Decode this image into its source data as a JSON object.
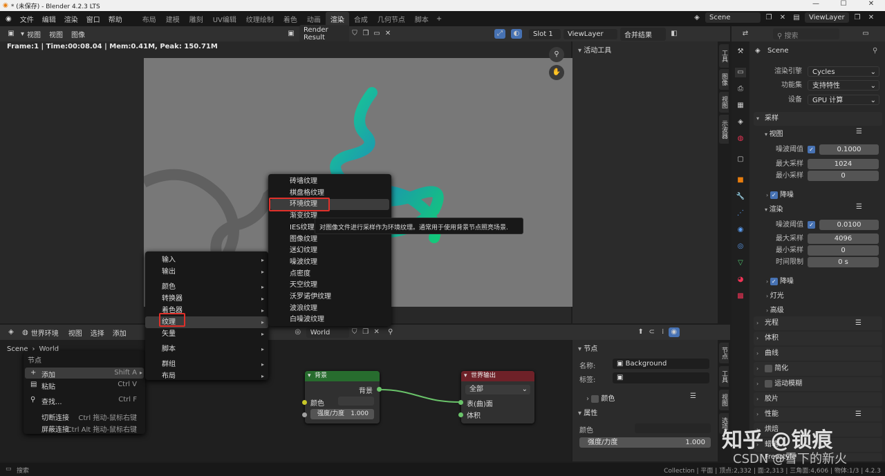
{
  "window": {
    "title": "* (未保存) - Blender 4.2.3 LTS"
  },
  "menu": [
    "文件",
    "编辑",
    "渲染",
    "窗口",
    "帮助"
  ],
  "workspaces": [
    "布局",
    "建模",
    "雕刻",
    "UV编辑",
    "纹理绘制",
    "着色",
    "动画",
    "渲染",
    "合成",
    "几何节点",
    "脚本"
  ],
  "active_workspace": "渲染",
  "top_right": {
    "scene": "Scene",
    "view_layer": "ViewLayer"
  },
  "image_editor": {
    "menus": [
      "视图",
      "视图",
      "图像"
    ],
    "image_name": "Render Result",
    "slot": "Slot 1",
    "view_layer": "ViewLayer",
    "pass": "合并结果",
    "status": "Frame:1 | Time:00:08.04 | Mem:0.41M, Peak: 150.71M",
    "sidebar_title": "活动工具",
    "sidebar_tabs": [
      "工具",
      "图像",
      "视图",
      "示波器"
    ]
  },
  "node_editor": {
    "type": "世界环境",
    "menus": [
      "视图",
      "选择",
      "添加"
    ],
    "world_name": "World",
    "breadcrumb": [
      "Scene",
      "World"
    ],
    "sidebar_tabs": [
      "节点",
      "工具",
      "视图",
      "选项"
    ],
    "nodes": {
      "background": {
        "title": "背景",
        "output": "背景",
        "color_label": "颜色",
        "strength_label": "强度/力度",
        "strength_value": "1.000"
      },
      "world_output": {
        "title": "世界输出",
        "target": "全部",
        "surface": "表(曲)面",
        "volume": "体积"
      }
    },
    "node_panel": {
      "section": "节点",
      "name_label": "名称:",
      "name_value": "Background",
      "label_label": "标签:",
      "color_section": "颜色",
      "props_section": "属性",
      "color_label": "颜色",
      "strength_label": "强度/力度",
      "strength_value": "1.000"
    }
  },
  "context_menu": {
    "title": "节点",
    "items": [
      {
        "label": "添加",
        "shortcut": "Shift A"
      },
      {
        "label": "粘贴",
        "shortcut": "Ctrl V"
      },
      {
        "label": "查找...",
        "shortcut": "Ctrl F"
      },
      {
        "label": "切断连接",
        "shortcut": "Ctrl 拖动-鼠标右键"
      },
      {
        "label": "屏蔽连接",
        "shortcut": "Ctrl Alt 拖动-鼠标右键"
      }
    ]
  },
  "add_menu": {
    "items": [
      "输入",
      "输出",
      "颜色",
      "转换器",
      "着色器",
      "纹理",
      "矢量",
      "脚本",
      "群组",
      "布局"
    ],
    "highlighted": "纹理"
  },
  "texture_menu": {
    "items": [
      "砖墙纹理",
      "棋盘格纹理",
      "环境纹理",
      "渐变纹理",
      "IES纹理",
      "图像纹理",
      "迷幻纹理",
      "噪波纹理",
      "点密度",
      "天空纹理",
      "沃罗诺伊纹理",
      "波浪纹理",
      "白噪波纹理"
    ],
    "highlighted": "环境纹理"
  },
  "tooltip": "对图像文件进行采样作为环境纹理。通常用于使用背景节点照亮场景.",
  "properties": {
    "search_placeholder": "搜索",
    "scene": "Scene",
    "render_engine_label": "渲染引擎",
    "render_engine": "Cycles",
    "feature_set_label": "功能集",
    "feature_set": "支持特性",
    "device_label": "设备",
    "device": "GPU 计算",
    "sampling": "采样",
    "viewport": "视图",
    "noise_threshold_label": "噪波阈值",
    "viewport_noise_threshold": "0.1000",
    "max_samples_label": "最大采样",
    "viewport_max_samples": "1024",
    "min_samples_label": "最小采样",
    "viewport_min_samples": "0",
    "denoise_label": "降噪",
    "render": "渲染",
    "render_noise_threshold": "0.0100",
    "render_max_samples": "4096",
    "render_min_samples": "0",
    "time_limit_label": "时间限制",
    "time_limit": "0 s",
    "sections": [
      "灯光",
      "高级",
      "光程",
      "体积",
      "曲线",
      "简化",
      "运动模糊",
      "胶片",
      "性能",
      "烘焙",
      "蜡笔",
      "Freestyle"
    ]
  },
  "statusbar": {
    "left": "搜索",
    "right": "Collection | 平面 | 顶点:2,332 | 面:2,313 | 三角面:4,606 | 物体:1/3 | 4.2.3"
  },
  "watermark": {
    "line1": "知乎 @锁痕",
    "line2": "CSDN @雪下的新火"
  },
  "colors": {
    "accent": "#4772b3",
    "shader_header": "#276c2e",
    "output_header": "#6e2128",
    "highlight_box": "#e0302a",
    "render_bg": "#777777",
    "helix": "#1ea882"
  }
}
